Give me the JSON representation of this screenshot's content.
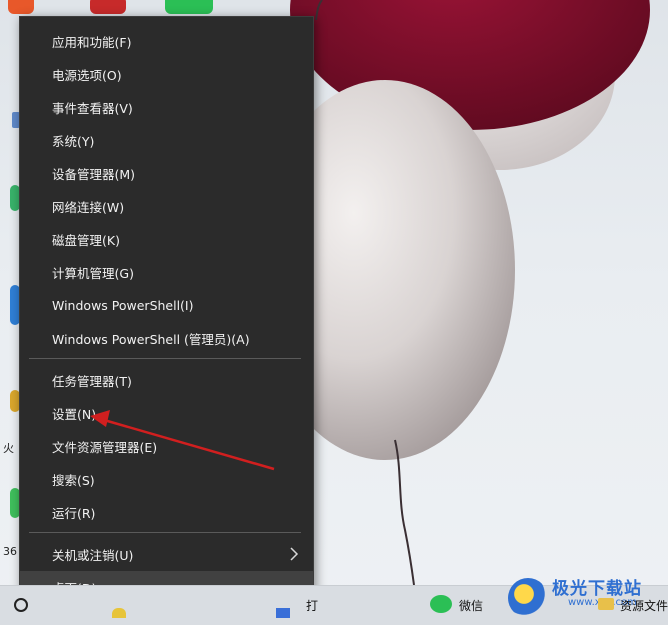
{
  "menu": {
    "items": [
      {
        "label": "应用和功能(F)"
      },
      {
        "label": "电源选项(O)"
      },
      {
        "label": "事件查看器(V)"
      },
      {
        "label": "系统(Y)"
      },
      {
        "label": "设备管理器(M)"
      },
      {
        "label": "网络连接(W)"
      },
      {
        "label": "磁盘管理(K)"
      },
      {
        "label": "计算机管理(G)"
      },
      {
        "label": "Windows PowerShell(I)"
      },
      {
        "label": "Windows PowerShell (管理员)(A)"
      },
      {
        "label": "任务管理器(T)"
      },
      {
        "label": "设置(N)"
      },
      {
        "label": "文件资源管理器(E)"
      },
      {
        "label": "搜索(S)"
      },
      {
        "label": "运行(R)"
      },
      {
        "label": "关机或注销(U)"
      },
      {
        "label": "桌面(D)"
      }
    ]
  },
  "desktop": {
    "left_labels": [
      "火",
      "36"
    ]
  },
  "taskbar": {
    "items": [
      {
        "label": "打"
      },
      {
        "label": "微信"
      },
      {
        "label": "资源文件"
      }
    ]
  },
  "watermark": {
    "text": "极光下载站",
    "url": "www.xz7.com"
  },
  "colors": {
    "menu_bg": "#2b2b2b",
    "menu_text": "#f2f2f2",
    "annotation_arrow": "#d11f1f",
    "balloon_red": "#7e0d2a"
  }
}
